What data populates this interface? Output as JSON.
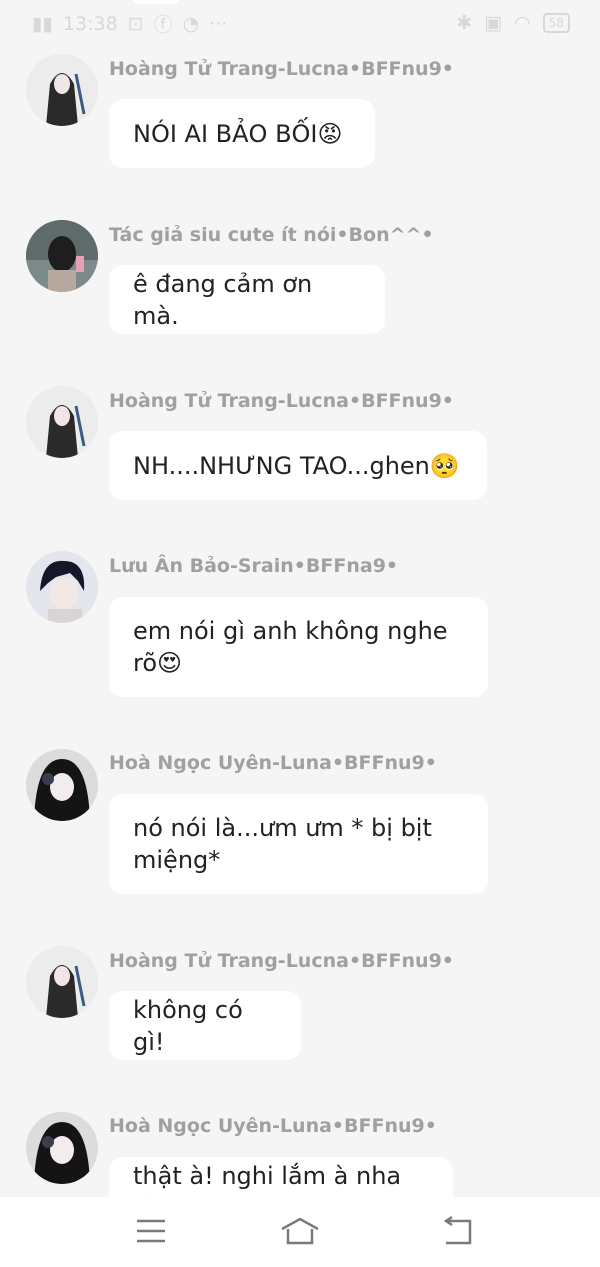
{
  "status_bar": {
    "time": "13:38",
    "battery": "58"
  },
  "messages": [
    {
      "sender": "Hoàng Tử Trang-Lucna•BFFnu9•",
      "text": "NÓI AI BẢO BỐI😡"
    },
    {
      "sender": "Tác giả siu cute ít nói•Bon^^•",
      "text": "ê đang cảm ơn mà."
    },
    {
      "sender": "Hoàng Tử Trang-Lucna•BFFnu9•",
      "text": "NH....NHƯNG TAO...ghen🥺"
    },
    {
      "sender": "Lưu Ân Bảo-Srain•BFFna9•",
      "text": "em nói gì anh không nghe rõ😍"
    },
    {
      "sender": "Hoà Ngọc Uyên-Luna•BFFnu9•",
      "text": "nó nói là...ưm ưm * bị bịt miệng*"
    },
    {
      "sender": "Hoàng Tử Trang-Lucna•BFFnu9•",
      "text": "không có gì!"
    },
    {
      "sender": "Hoà Ngọc Uyên-Luna•BFFnu9•",
      "text": "thật à! nghi lắm à nha 😏"
    }
  ]
}
